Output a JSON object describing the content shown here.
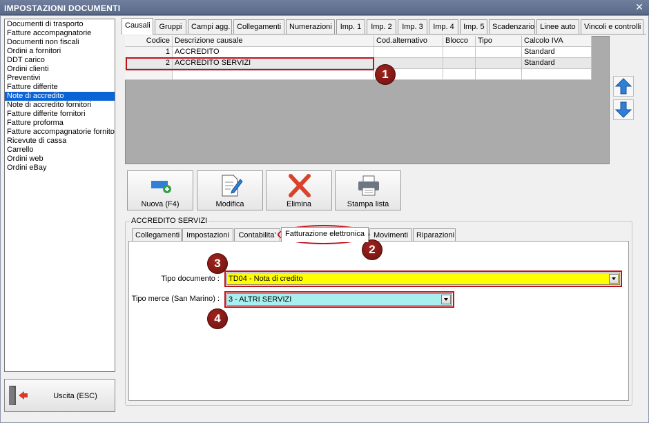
{
  "window": {
    "title": "IMPOSTAZIONI DOCUMENTI",
    "close_glyph": "✕"
  },
  "doc_list": {
    "selected_index": 9,
    "items": [
      "Documenti di trasporto",
      "Fatture accompagnatorie",
      "Documenti non fiscali",
      "Ordini a fornitori",
      "DDT carico",
      "Ordini clienti",
      "Preventivi",
      "Fatture differite",
      "Note di accredito",
      "Note di accredito fornitori",
      "Fatture differite fornitori",
      "Fatture proforma",
      "Fatture accompagnatorie fornito",
      "Ricevute di cassa",
      "Carrello",
      "Ordini web",
      "Ordini eBay"
    ]
  },
  "exit_button": {
    "label": "Uscita (ESC)"
  },
  "top_tabs": [
    "Causali",
    "Gruppi",
    "Campi agg.",
    "Collegamenti",
    "Numerazioni",
    "Imp. 1",
    "Imp. 2",
    "Imp. 3",
    "Imp. 4",
    "Imp. 5",
    "Scadenzario",
    "Linee auto",
    "Vincoli e controlli"
  ],
  "grid": {
    "columns": [
      "Codice",
      "Descrizione causale",
      "Cod.alternativo",
      "Blocco",
      "Tipo",
      "Calcolo IVA"
    ],
    "rows": [
      [
        "1",
        "ACCREDITO",
        "",
        "",
        "",
        "Standard"
      ],
      [
        "2",
        "ACCREDITO SERVIZI",
        "",
        "",
        "",
        "Standard"
      ],
      [
        "",
        "",
        "",
        "",
        "",
        ""
      ]
    ]
  },
  "toolbar": {
    "new_label": "Nuova (F4)",
    "edit_label": "Modifica",
    "delete_label": "Elimina",
    "print_label": "Stampa lista"
  },
  "detail": {
    "title": "ACCREDITO SERVIZI",
    "tabs": [
      "Collegamenti",
      "Impostazioni",
      "Contabilita'",
      "Fatturazione elettronica",
      "Movimenti",
      "Riparazioni"
    ],
    "tipo_documento": {
      "label": "Tipo documento :",
      "value": "TD04 - Nota di credito"
    },
    "tipo_merce": {
      "label": "Tipo merce (San Marino) :",
      "value": "3 - ALTRI SERVIZI"
    }
  },
  "markers": [
    "1",
    "2",
    "3",
    "4"
  ],
  "colors": {
    "titlebar": "#596a88",
    "selection": "#0a64d6",
    "annotation_red": "#c0101a",
    "combo_yellow": "#ffff00",
    "combo_cyan": "#a8f0f0"
  }
}
